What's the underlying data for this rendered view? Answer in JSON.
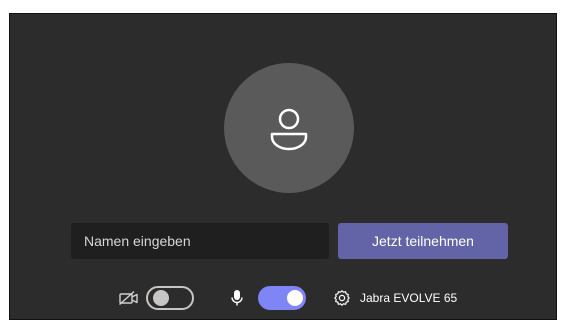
{
  "prejoin": {
    "name_input": {
      "value": "",
      "placeholder": "Namen eingeben"
    },
    "join_button_label": "Jetzt teilnehmen",
    "controls": {
      "camera": {
        "icon": "camera-off-icon",
        "enabled": false
      },
      "microphone": {
        "icon": "microphone-icon",
        "enabled": true
      },
      "device_settings": {
        "icon": "gear-icon",
        "label": "Jabra EVOLVE 65"
      }
    },
    "avatar_icon": "person-icon"
  },
  "colors": {
    "panel_background": "#2d2c2c",
    "avatar_background": "#5b5a5a",
    "input_background": "#201f1f",
    "accent": "#6264a7",
    "toggle_on": "#7f85f5"
  }
}
